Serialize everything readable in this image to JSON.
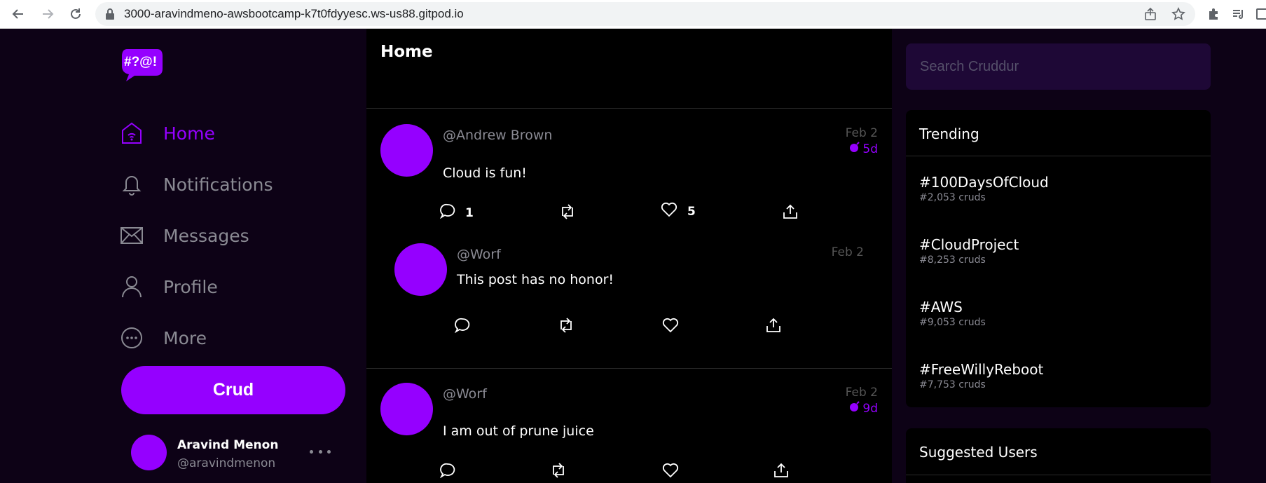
{
  "browser": {
    "url": "3000-aravindmeno-awsbootcamp-k7t0fdyyesc.ws-us88.gitpod.io"
  },
  "colors": {
    "accent": "#9500ff",
    "sidebar_bg": "#0d0216",
    "feed_bg": "#000000",
    "muted_text": "#8a8a93",
    "search_bg": "#1e0836"
  },
  "logo": {
    "text": "#?@!"
  },
  "sidebar": {
    "items": [
      {
        "label": "Home",
        "icon": "home-icon",
        "active": true
      },
      {
        "label": "Notifications",
        "icon": "bell-icon",
        "active": false
      },
      {
        "label": "Messages",
        "icon": "envelope-icon",
        "active": false
      },
      {
        "label": "Profile",
        "icon": "user-icon",
        "active": false
      },
      {
        "label": "More",
        "icon": "more-circle-icon",
        "active": false
      }
    ],
    "crud_button": "Crud",
    "user": {
      "name": "Aravind Menon",
      "handle": "@aravindmenon"
    }
  },
  "feed": {
    "title": "Home",
    "posts": [
      {
        "handle": "@Andrew Brown",
        "message": "Cloud is fun!",
        "date": "Feb 2",
        "expires": "5d",
        "reply_count": "1",
        "like_count": "5"
      },
      {
        "handle": "@Worf",
        "message": "This post has no honor!",
        "date": "Feb 2",
        "expires": "",
        "reply_count": "",
        "like_count": ""
      },
      {
        "handle": "@Worf",
        "message": "I am out of prune juice",
        "date": "Feb 2",
        "expires": "9d",
        "reply_count": "",
        "like_count": ""
      }
    ]
  },
  "search": {
    "placeholder": "Search Cruddur"
  },
  "trending": {
    "title": "Trending",
    "items": [
      {
        "tag": "#100DaysOfCloud",
        "count": "#2,053 cruds"
      },
      {
        "tag": "#CloudProject",
        "count": "#8,253 cruds"
      },
      {
        "tag": "#AWS",
        "count": "#9,053 cruds"
      },
      {
        "tag": "#FreeWillyReboot",
        "count": "#7,753 cruds"
      }
    ]
  },
  "suggested_users": {
    "title": "Suggested Users"
  }
}
